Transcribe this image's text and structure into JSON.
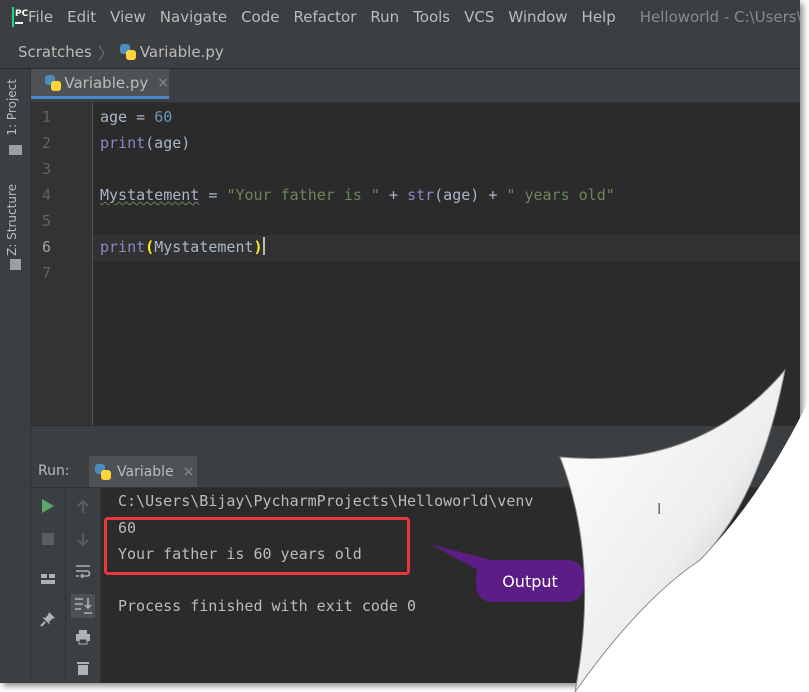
{
  "menubar": {
    "logo_text": "PC",
    "items": [
      "File",
      "Edit",
      "View",
      "Navigate",
      "Code",
      "Refactor",
      "Run",
      "Tools",
      "VCS",
      "Window",
      "Help"
    ],
    "window_title": "Helloworld - C:\\Users\\"
  },
  "breadcrumb": {
    "items": [
      "Scratches",
      "Variable.py"
    ]
  },
  "left_strip": {
    "project_tab": "1: Project",
    "structure_tab": "Z: Structure"
  },
  "editor": {
    "tab_label": "Variable.py",
    "tab_close": "×",
    "line_numbers": [
      "1",
      "2",
      "3",
      "4",
      "5",
      "6",
      "7"
    ],
    "current_line": 6,
    "lines": {
      "l1_var": "age = ",
      "l1_num": "60",
      "l2_fn": "print",
      "l2_rest": "(age)",
      "l4_var": "Mystatement",
      "l4_eq": " = ",
      "l4_str1": "\"Your father is \"",
      "l4_plus1": " + ",
      "l4_fn": "str",
      "l4_arg": "(age)",
      "l4_plus2": " + ",
      "l4_str2": "\" years old\"",
      "l6_fn": "print",
      "l6_open": "(",
      "l6_arg": "Mystatement",
      "l6_close": ")"
    }
  },
  "run_panel": {
    "label": "Run:",
    "tab_label": "Variable",
    "tab_close": "×",
    "output": [
      "C:\\Users\\Bijay\\PycharmProjects\\Helloworld\\venv",
      "60",
      "Your father is 60 years old",
      "",
      "Process finished with exit code 0"
    ]
  },
  "annotation": {
    "callout_text": "Output",
    "box_color": "#e8383f",
    "callout_color": "#5c1d86"
  },
  "colors": {
    "background": "#3c3f41",
    "editor_bg": "#2b2b2b",
    "keyword_fn": "#8888c6",
    "string": "#6a8759",
    "number": "#6897bb"
  }
}
